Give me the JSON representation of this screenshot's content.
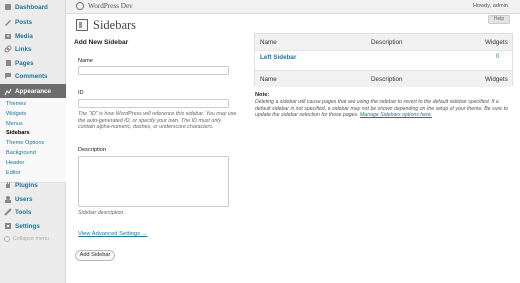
{
  "header": {
    "site_title": "WordPress Dev",
    "howdy": "Howdy, admin",
    "help_label": "Help"
  },
  "sidebar": {
    "items": [
      {
        "label": "Dashboard",
        "icon": "dashboard-icon"
      },
      {
        "label": "Posts",
        "icon": "posts-icon"
      },
      {
        "label": "Media",
        "icon": "media-icon"
      },
      {
        "label": "Links",
        "icon": "links-icon"
      },
      {
        "label": "Pages",
        "icon": "pages-icon"
      },
      {
        "label": "Comments",
        "icon": "comments-icon"
      },
      {
        "label": "Appearance",
        "icon": "appearance-icon"
      },
      {
        "label": "Plugins",
        "icon": "plugins-icon"
      },
      {
        "label": "Users",
        "icon": "users-icon"
      },
      {
        "label": "Tools",
        "icon": "tools-icon"
      },
      {
        "label": "Settings",
        "icon": "settings-icon"
      }
    ],
    "submenu": [
      "Themes",
      "Widgets",
      "Menus",
      "Sidebars",
      "Theme Options",
      "Background",
      "Header",
      "Editor"
    ],
    "collapse_label": "Collapse menu"
  },
  "page": {
    "title": "Sidebars"
  },
  "form": {
    "title": "Add New Sidebar",
    "name_label": "Name",
    "name_value": "",
    "id_label": "ID",
    "id_value": "",
    "id_help": "The \"ID\" is how WordPress will reference this sidebar. You may use the auto-generated ID, or specify your own. The ID must only contain alpha-numeric, dashes, or underscore characters.",
    "description_label": "Description",
    "description_value": "",
    "description_help": "Sidebar description.",
    "advanced_link": "View Advanced Settings →",
    "submit_label": "Add Sidebar"
  },
  "table": {
    "columns": [
      "Name",
      "Description",
      "Widgets"
    ],
    "rows": [
      {
        "name": "Left Sidebar",
        "description": "",
        "widgets": "0"
      }
    ]
  },
  "note": {
    "title": "Note:",
    "text": "Deleting a sidebar will cause pages that are using the sidebar to revert to the default sidebar specified. If a default sidebar is not specified, a sidebar may not be shown depending on the setup of your theme. Be sure to update the sidebar selection for those pages. ",
    "link": "Manage Sidebars options here."
  },
  "colors": {
    "accent": "#21759b",
    "active_menu": "#6d6d6d"
  }
}
